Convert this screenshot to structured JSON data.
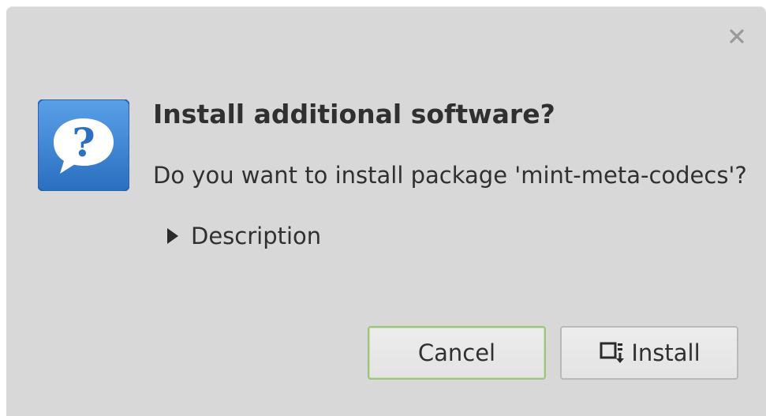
{
  "dialog": {
    "title": "Install additional software?",
    "message": "Do you want to install package 'mint-meta-codecs'?",
    "expander_label": "Description",
    "close_icon": "close-icon",
    "main_icon": "question-icon"
  },
  "buttons": {
    "cancel_label": "Cancel",
    "install_label": "Install",
    "install_icon": "package-install-icon"
  },
  "colors": {
    "dialog_bg": "#d8d8d8",
    "text": "#303030",
    "focus_border": "#9cc47b",
    "icon_blue": "#3e86d6"
  }
}
